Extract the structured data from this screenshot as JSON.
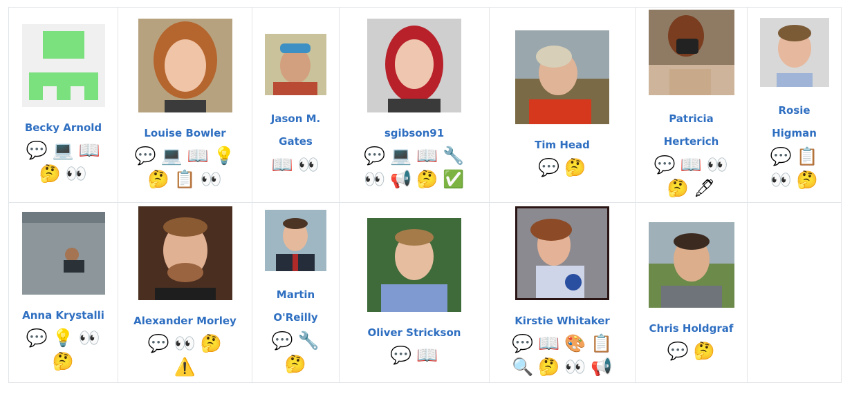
{
  "contributors": [
    {
      "name": "Becky Arnold",
      "avatar": "identicon",
      "emojis": [
        "💬",
        "💻",
        "📖",
        "🤔",
        "👀"
      ]
    },
    {
      "name": "Louise Bowler",
      "avatar": "photo",
      "emojis": [
        "💬",
        "💻",
        "📖",
        "💡",
        "🤔",
        "📋",
        "👀"
      ]
    },
    {
      "name": "Jason M. Gates",
      "avatar": "photo",
      "emojis": [
        "📖",
        "👀"
      ]
    },
    {
      "name": "sgibson91",
      "avatar": "photo",
      "emojis": [
        "💬",
        "💻",
        "📖",
        "🔧",
        "👀",
        "📢",
        "🤔",
        "✅"
      ]
    },
    {
      "name": "Tim Head",
      "avatar": "photo",
      "emojis": [
        "💬",
        "🤔"
      ]
    },
    {
      "name": "Patricia Herterich",
      "avatar": "photo",
      "emojis": [
        "💬",
        "📖",
        "👀",
        "🤔",
        "🖋"
      ]
    },
    {
      "name": "Rosie Higman",
      "avatar": "photo",
      "emojis": [
        "💬",
        "📋",
        "👀",
        "🤔"
      ]
    },
    {
      "name": "Anna Krystalli",
      "avatar": "photo",
      "emojis": [
        "💬",
        "💡",
        "👀",
        "🤔"
      ]
    },
    {
      "name": "Alexander Morley",
      "avatar": "photo",
      "emojis": [
        "💬",
        "👀",
        "🤔",
        "⚠️"
      ]
    },
    {
      "name": "Martin O'Reilly",
      "avatar": "photo",
      "emojis": [
        "💬",
        "🔧",
        "🤔"
      ]
    },
    {
      "name": "Oliver Strickson",
      "avatar": "photo",
      "emojis": [
        "💬",
        "📖"
      ]
    },
    {
      "name": "Kirstie Whitaker",
      "avatar": "photo",
      "emojis": [
        "💬",
        "📖",
        "🎨",
        "📋",
        "🔍",
        "🤔",
        "👀",
        "📢"
      ]
    },
    {
      "name": "Chris Holdgraf",
      "avatar": "photo",
      "emojis": [
        "💬",
        "🤔"
      ]
    }
  ],
  "colors": {
    "link": "#2f6fc1",
    "identicon_fg": "#7be07e",
    "identicon_bg": "#f0f0f0",
    "border": "#e1e4e8"
  }
}
